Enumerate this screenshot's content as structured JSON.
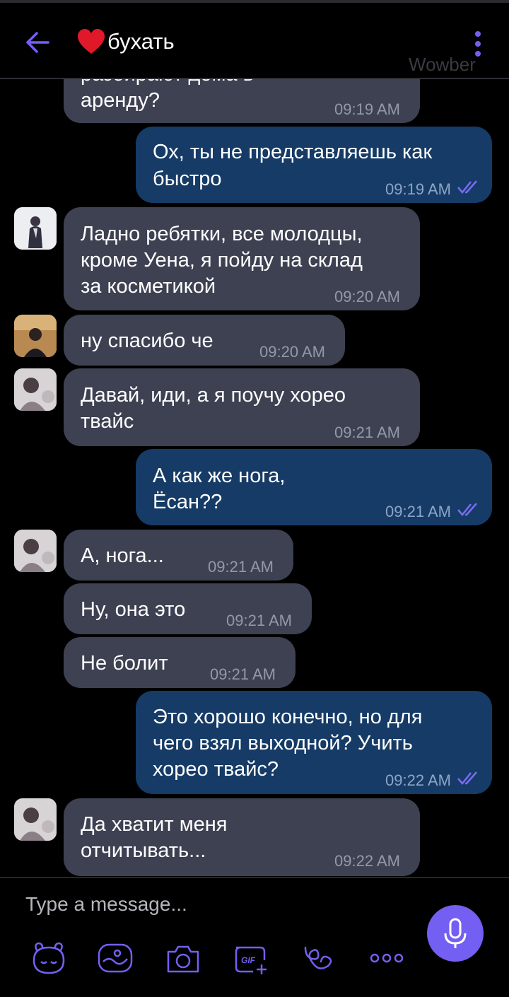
{
  "header": {
    "title": "бухать",
    "title_icon": "heart-emoji",
    "back_icon": "arrow-left-icon",
    "menu_icon": "more-vertical-icon",
    "watermark": "Wowber",
    "accent": "#7360f2"
  },
  "messages": [
    {
      "dir": "in",
      "text_lines": [
        "арендy?"
      ],
      "time": "09:19 AM",
      "partial_top": "разбирают дома в"
    },
    {
      "dir": "out",
      "text_lines": [
        "Ох, ты не представляешь как",
        "быстро"
      ],
      "time": "09:19 AM",
      "status": "read"
    },
    {
      "dir": "in",
      "avatar": "avatar-1",
      "text_lines": [
        "Ладно ребятки, все молодцы,",
        "кроме Уена, я пойду на склад",
        "за косметикой"
      ],
      "time": "09:20 AM"
    },
    {
      "dir": "in",
      "avatar": "avatar-2",
      "text_lines": [
        "ну спасибо че"
      ],
      "time": "09:20 AM"
    },
    {
      "dir": "in",
      "avatar": "avatar-3",
      "text_lines": [
        "Давай, иди, а я поучу хорео",
        "твайс"
      ],
      "time": "09:21 AM"
    },
    {
      "dir": "out",
      "text_lines": [
        "А как же нога,",
        "Ёсан??"
      ],
      "time": "09:21 AM",
      "status": "read"
    },
    {
      "dir": "in",
      "avatar": "avatar-3",
      "text_lines": [
        "А, нога..."
      ],
      "time": "09:21 AM"
    },
    {
      "dir": "in",
      "text_lines": [
        "Ну, она это"
      ],
      "time": "09:21 AM"
    },
    {
      "dir": "in",
      "text_lines": [
        "Не болит"
      ],
      "time": "09:21 AM"
    },
    {
      "dir": "out",
      "text_lines": [
        "Это хорошо конечно, но для",
        "чего взял выходной? Учить",
        "хорео твайс?"
      ],
      "time": "09:22 AM",
      "status": "read"
    },
    {
      "dir": "in",
      "avatar": "avatar-3",
      "text_lines": [
        "Да хватит меня",
        "отчитывать..."
      ],
      "time": "09:22 AM"
    }
  ],
  "composer": {
    "placeholder": "Type a message...",
    "tools": [
      "sticker-bear-icon",
      "doodle-icon",
      "camera-icon",
      "gif-icon",
      "emoji-vine-icon",
      "more-dots-icon"
    ],
    "mic_icon": "microphone-icon"
  }
}
